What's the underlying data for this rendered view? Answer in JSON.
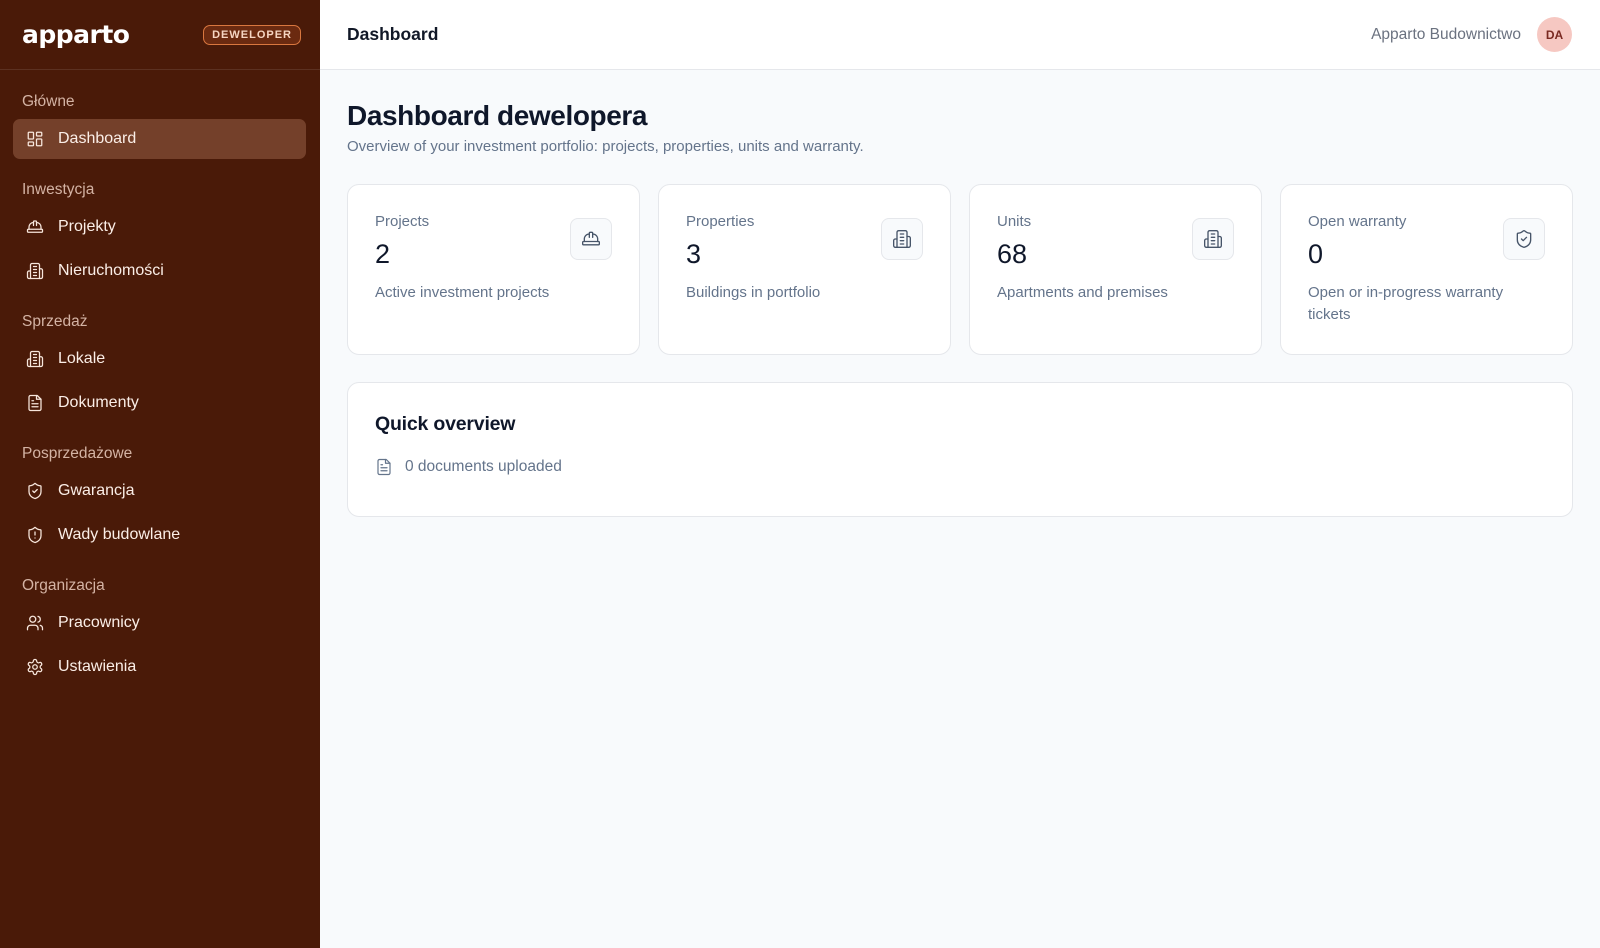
{
  "brand": {
    "logo": "apparto",
    "role_badge": "DEWELOPER"
  },
  "sidebar": {
    "sections": [
      {
        "label": "Główne",
        "items": [
          {
            "label": "Dashboard",
            "icon": "layout-grid-icon",
            "active": true
          }
        ]
      },
      {
        "label": "Inwestycja",
        "items": [
          {
            "label": "Projekty",
            "icon": "hard-hat-icon"
          },
          {
            "label": "Nieruchomości",
            "icon": "building-icon"
          }
        ]
      },
      {
        "label": "Sprzedaż",
        "items": [
          {
            "label": "Lokale",
            "icon": "building-icon"
          },
          {
            "label": "Dokumenty",
            "icon": "file-text-icon"
          }
        ]
      },
      {
        "label": "Posprzedażowe",
        "items": [
          {
            "label": "Gwarancja",
            "icon": "shield-check-icon"
          },
          {
            "label": "Wady budowlane",
            "icon": "shield-alert-icon"
          }
        ]
      },
      {
        "label": "Organizacja",
        "items": [
          {
            "label": "Pracownicy",
            "icon": "users-icon"
          },
          {
            "label": "Ustawienia",
            "icon": "gear-icon"
          }
        ]
      }
    ]
  },
  "topbar": {
    "title": "Dashboard",
    "org_name": "Apparto Budownictwo",
    "avatar_initials": "DA"
  },
  "main": {
    "title": "Dashboard dewelopera",
    "subtitle": "Overview of your investment portfolio: projects, properties, units and warranty.",
    "stats": [
      {
        "label": "Projects",
        "value": "2",
        "description": "Active investment projects",
        "icon": "hard-hat-icon"
      },
      {
        "label": "Properties",
        "value": "3",
        "description": "Buildings in portfolio",
        "icon": "building-icon"
      },
      {
        "label": "Units",
        "value": "68",
        "description": "Apartments and premises",
        "icon": "building-icon"
      },
      {
        "label": "Open warranty",
        "value": "0",
        "description": "Open or in-progress warranty tickets",
        "icon": "shield-check-icon"
      }
    ],
    "overview": {
      "title": "Quick overview",
      "documents_text": "0 documents uploaded",
      "icon": "file-text-icon"
    }
  },
  "colors": {
    "sidebar_bg": "#4a1a08",
    "active_item_bg": "#74402a",
    "badge_border": "#d9773f",
    "avatar_bg": "#f6c8c2",
    "page_bg": "#f8fafc"
  }
}
